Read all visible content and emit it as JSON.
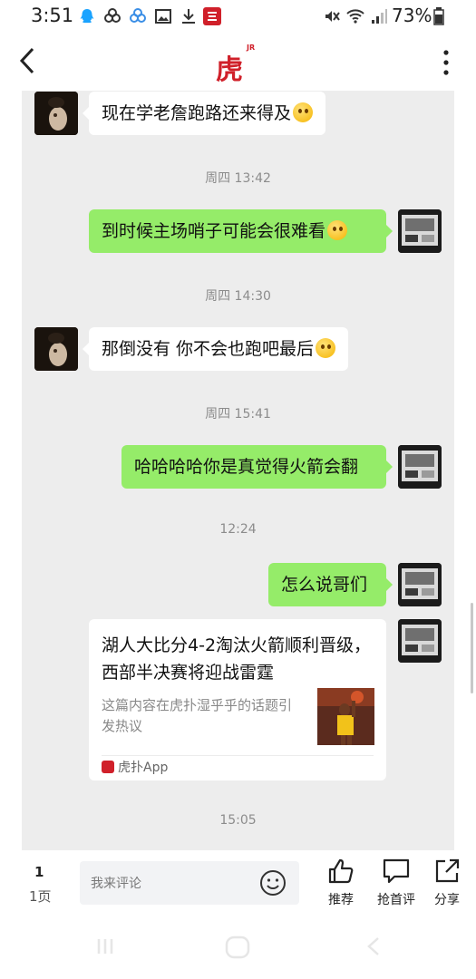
{
  "status_bar": {
    "time": "3:51",
    "battery": "73%",
    "left_icons": [
      "qq-icon",
      "cloud-link-icon",
      "cloud-link-icon",
      "image-icon",
      "download-icon",
      "hupu-app-icon"
    ],
    "right_icons": [
      "mute-icon",
      "wifi-icon",
      "signal-icon",
      "battery-icon"
    ]
  },
  "header": {
    "logo": "虎扑",
    "logo_sup": "JR",
    "back_icon": "chevron-left-icon",
    "more_icon": "more-vertical-icon"
  },
  "chat": {
    "messages": [
      {
        "side": "in",
        "text": "现在学老詹跑路还来得及"
      },
      {
        "timestamp": "周四 13:42"
      },
      {
        "side": "out",
        "text": "到时候主场哨子可能会很难看"
      },
      {
        "timestamp": "周四 14:30"
      },
      {
        "side": "in",
        "text": "那倒没有  你不会也跑吧最后"
      },
      {
        "timestamp": "周四 15:41"
      },
      {
        "side": "out",
        "text": "哈哈哈哈你是真觉得火箭会翻"
      },
      {
        "timestamp": "12:24"
      },
      {
        "side": "out",
        "text": "怎么说哥们"
      }
    ],
    "card": {
      "title": "湖人大比分4-2淘汰火箭顺利晋级，西部半决赛将迎战雷霆",
      "description": "这篇内容在虎扑湿乎乎的话题引发热议",
      "source": "虎扑App"
    },
    "last_timestamp": "15:05"
  },
  "bottom_bar": {
    "page_current": "1",
    "page_total": "1页",
    "comment_placeholder": "我来评论",
    "actions": [
      {
        "label": "推荐",
        "icon": "thumbs-up-icon"
      },
      {
        "label": "抢首评",
        "icon": "comment-icon"
      },
      {
        "label": "分享",
        "icon": "share-icon"
      }
    ]
  },
  "colors": {
    "brand_red": "#d0202a",
    "chat_bg": "#ededed",
    "out_bubble": "#95ec69",
    "in_bubble": "#ffffff"
  }
}
